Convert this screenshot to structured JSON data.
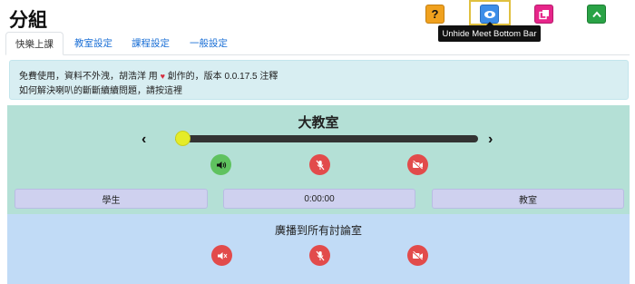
{
  "header": {
    "title": "分組",
    "tooltip": "Unhide Meet Bottom Bar"
  },
  "topbar": {
    "buttons": [
      {
        "name": "help",
        "icon": "question-icon",
        "color": "#f0a11e"
      },
      {
        "name": "unhide",
        "icon": "eye-icon",
        "color": "#3d8ee8"
      },
      {
        "name": "pip",
        "icon": "copy-windows-icon",
        "color": "#e7258a"
      },
      {
        "name": "collapse",
        "icon": "chevron-up-icon",
        "color": "#2aa346"
      }
    ]
  },
  "tabs": [
    "快樂上課",
    "教室設定",
    "課程設定",
    "一般設定"
  ],
  "notice": {
    "line1_prefix": "免費使用，資料不外洩，胡浩洋 用",
    "heart": "♥",
    "line1_suffix": "創作的，版本 0.0.17.5 注釋",
    "line2": "如何解決喇叭的斷斷續續問題，請按這裡"
  },
  "room": {
    "title": "大教室",
    "prev": "‹",
    "next": "›",
    "slider_value": 0,
    "controls": [
      {
        "icon": "speaker-icon",
        "state": "on",
        "color": "#5fc25f"
      },
      {
        "icon": "mic-off-icon",
        "state": "off",
        "color": "#e24b4b"
      },
      {
        "icon": "video-off-icon",
        "state": "off",
        "color": "#e24b4b"
      }
    ]
  },
  "bar": {
    "left": "學生",
    "timer": "0:00:00",
    "right": "教室"
  },
  "broadcast": {
    "title": "廣播到所有討論室",
    "controls": [
      {
        "icon": "speaker-muted-icon",
        "state": "off",
        "color": "#e24b4b"
      },
      {
        "icon": "mic-off-icon",
        "state": "off",
        "color": "#e24b4b"
      },
      {
        "icon": "video-off-icon",
        "state": "off",
        "color": "#e24b4b"
      }
    ]
  }
}
